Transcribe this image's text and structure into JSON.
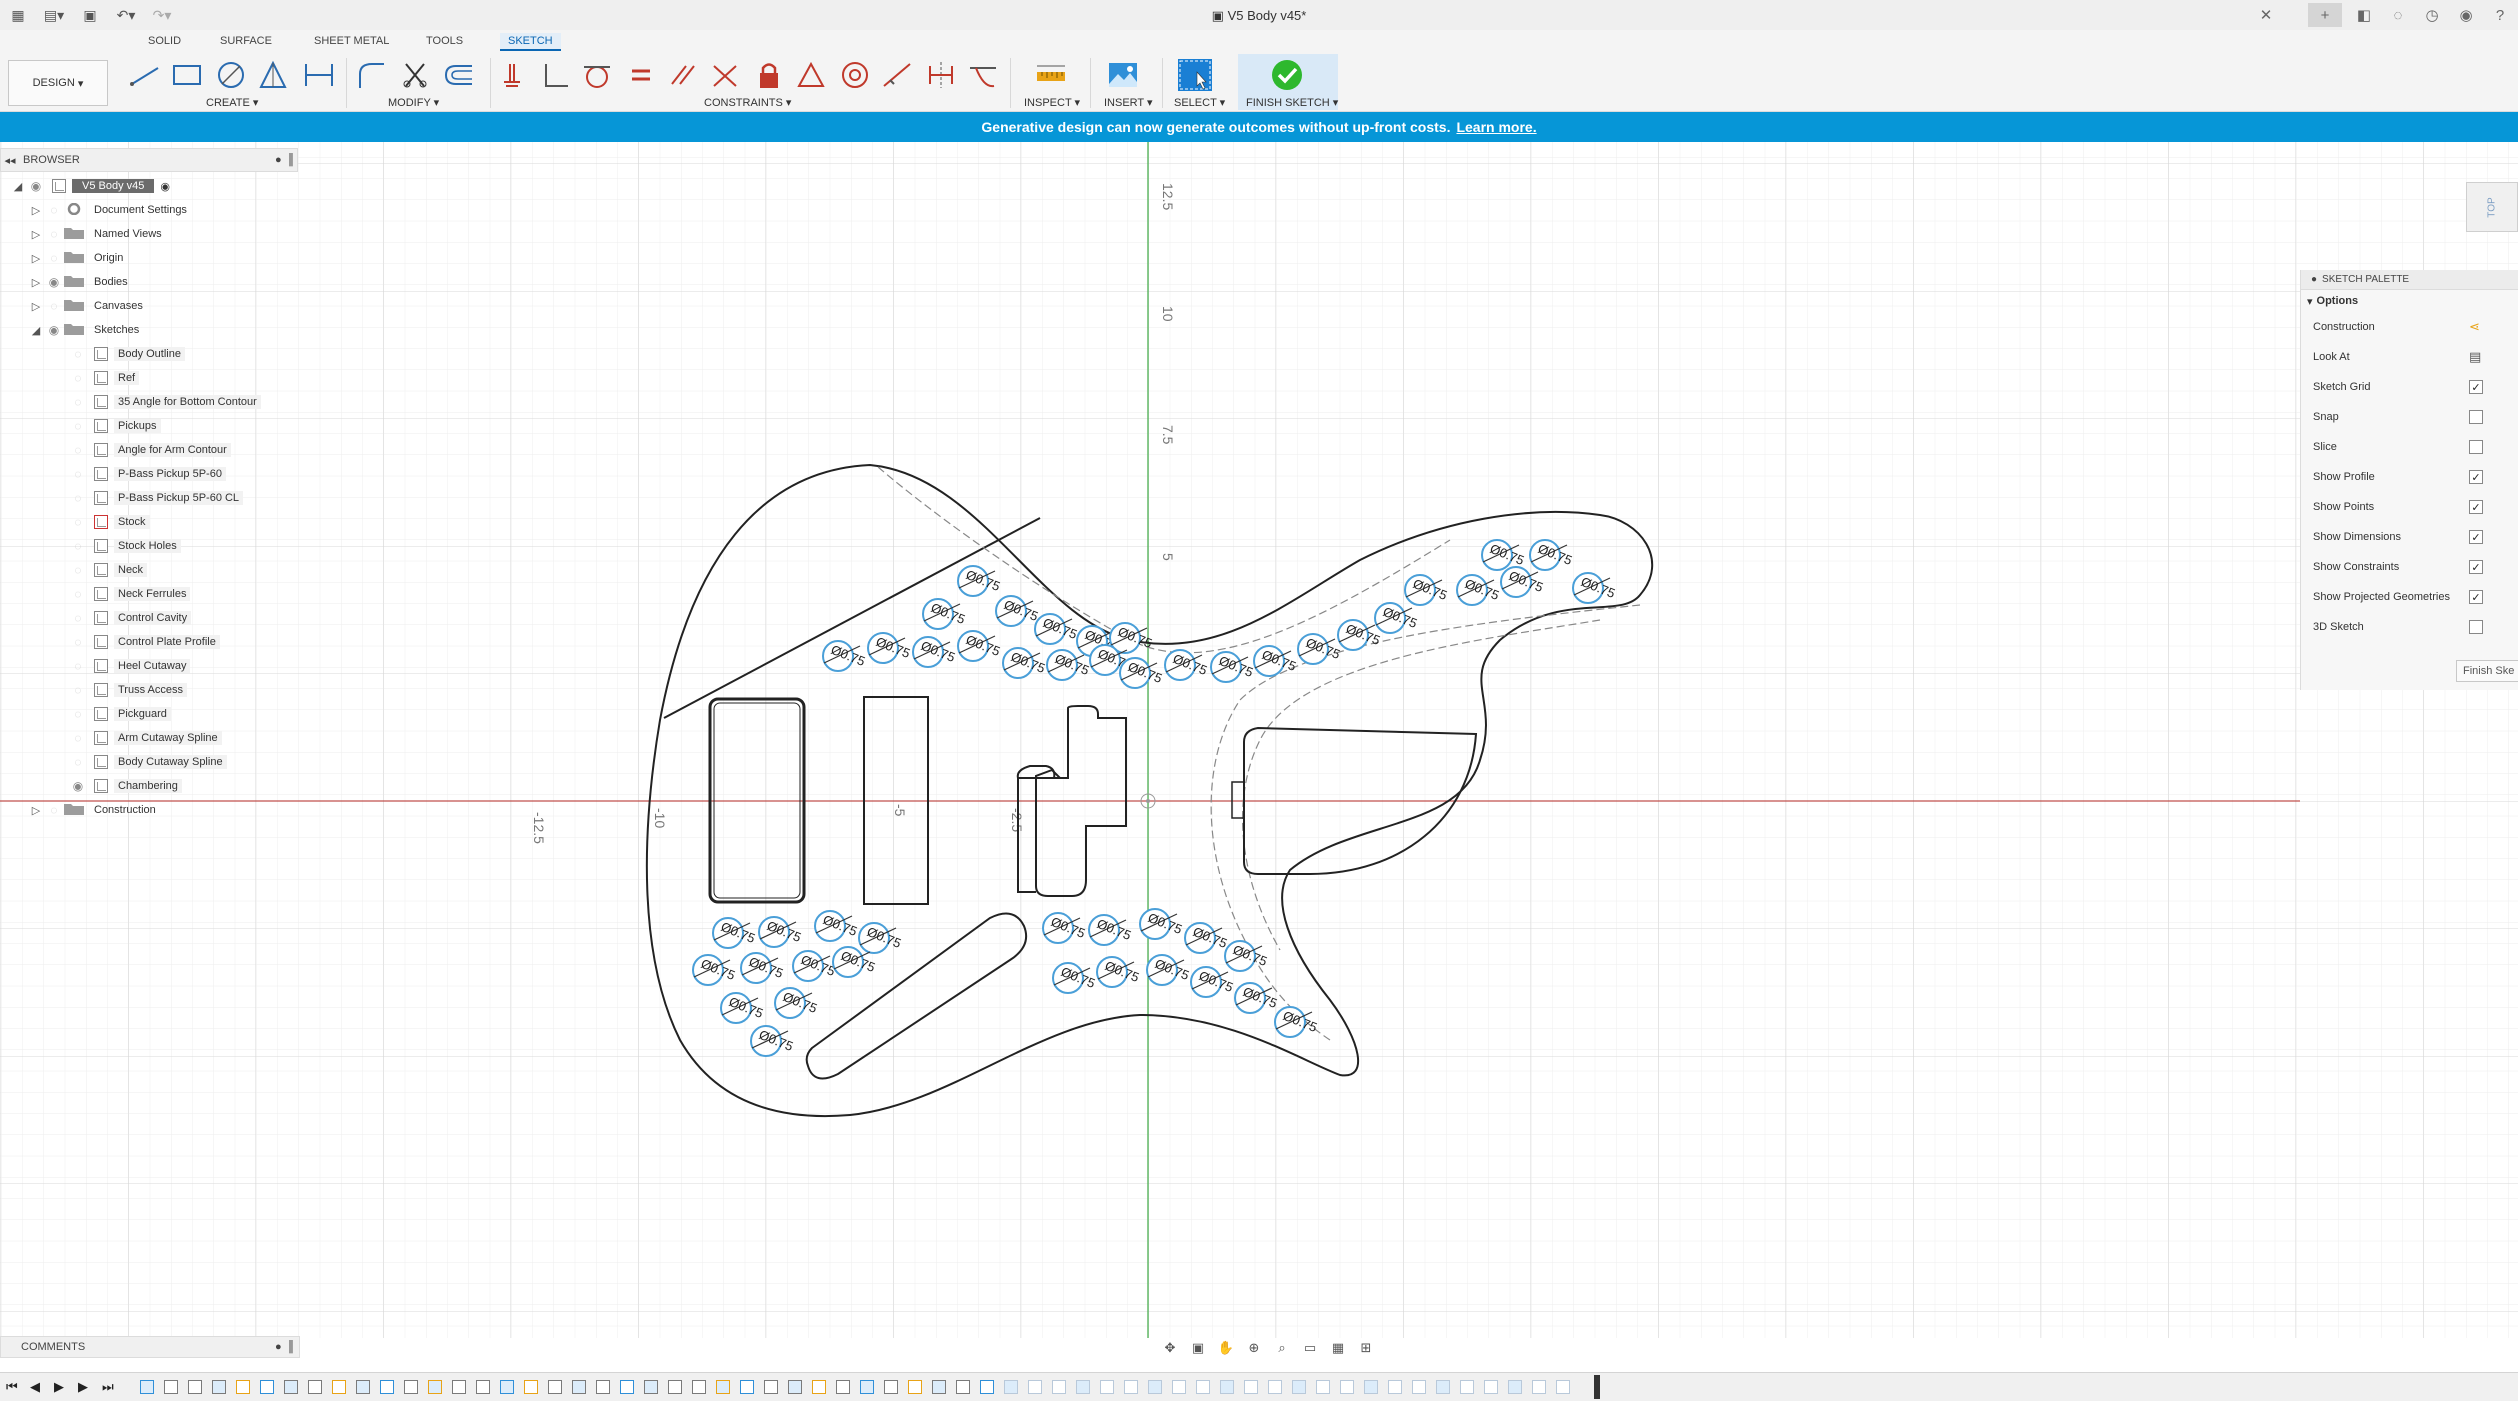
{
  "app": {
    "document_title": "V5 Body v45*",
    "workspace": "DESIGN"
  },
  "tabs": [
    "SOLID",
    "SURFACE",
    "SHEET METAL",
    "TOOLS",
    "SKETCH"
  ],
  "active_tab": "SKETCH",
  "toolbar": {
    "groups": {
      "create": "CREATE",
      "modify": "MODIFY",
      "constraints": "CONSTRAINTS",
      "inspect": "INSPECT",
      "insert": "INSERT",
      "select": "SELECT",
      "finish_sketch": "FINISH SKETCH"
    }
  },
  "banner": {
    "text": "Generative design can now generate outcomes without up-front costs.",
    "link": "Learn more."
  },
  "browser": {
    "title": "BROWSER",
    "root": "V5 Body v45",
    "top_items": [
      {
        "label": "Document Settings",
        "icon": "gear-icon",
        "visible": false
      },
      {
        "label": "Named Views",
        "icon": "folder-icon",
        "visible": false
      },
      {
        "label": "Origin",
        "icon": "folder-icon",
        "visible": false
      },
      {
        "label": "Bodies",
        "icon": "folder-icon",
        "visible": true
      },
      {
        "label": "Canvases",
        "icon": "folder-icon",
        "visible": false
      },
      {
        "label": "Sketches",
        "icon": "folder-icon",
        "visible": true
      }
    ],
    "sketches": [
      {
        "label": "Body Outline",
        "visible": false
      },
      {
        "label": "Ref",
        "visible": false
      },
      {
        "label": "35 Angle for Bottom Contour",
        "visible": false
      },
      {
        "label": "Pickups",
        "visible": false
      },
      {
        "label": "Angle for Arm Contour",
        "visible": false
      },
      {
        "label": "P-Bass Pickup 5P-60",
        "visible": false
      },
      {
        "label": "P-Bass Pickup 5P-60 CL",
        "visible": false
      },
      {
        "label": "Stock",
        "visible": false,
        "locked": true
      },
      {
        "label": "Stock Holes",
        "visible": false
      },
      {
        "label": "Neck",
        "visible": false
      },
      {
        "label": "Neck Ferrules",
        "visible": false
      },
      {
        "label": "Control Cavity",
        "visible": false
      },
      {
        "label": "Control Plate Profile",
        "visible": false
      },
      {
        "label": "Heel Cutaway",
        "visible": false
      },
      {
        "label": "Truss Access",
        "visible": false
      },
      {
        "label": "Pickguard",
        "visible": false
      },
      {
        "label": "Arm Cutaway Spline",
        "visible": false
      },
      {
        "label": "Body Cutaway Spline",
        "visible": false
      },
      {
        "label": "Chambering",
        "visible": true
      }
    ],
    "construction": "Construction"
  },
  "sketch_palette": {
    "title": "SKETCH PALETTE",
    "section": "Options",
    "options": [
      {
        "label": "Construction",
        "type": "icon",
        "checked": false
      },
      {
        "label": "Look At",
        "type": "icon",
        "checked": false
      },
      {
        "label": "Sketch Grid",
        "type": "checkbox",
        "checked": true
      },
      {
        "label": "Snap",
        "type": "checkbox",
        "checked": false
      },
      {
        "label": "Slice",
        "type": "checkbox",
        "checked": false
      },
      {
        "label": "Show Profile",
        "type": "checkbox",
        "checked": true
      },
      {
        "label": "Show Points",
        "type": "checkbox",
        "checked": true
      },
      {
        "label": "Show Dimensions",
        "type": "checkbox",
        "checked": true
      },
      {
        "label": "Show Constraints",
        "type": "checkbox",
        "checked": true
      },
      {
        "label": "Show Projected Geometries",
        "type": "checkbox",
        "checked": true
      },
      {
        "label": "3D Sketch",
        "type": "checkbox",
        "checked": false
      }
    ],
    "finish_button": "Finish Ske"
  },
  "viewcube": {
    "face": "TOP"
  },
  "comments": {
    "title": "COMMENTS"
  },
  "canvas": {
    "axis_labels_vertical": [
      "12.5",
      "10",
      "7.5",
      "5"
    ],
    "axis_labels_horizontal": [
      "-12.5",
      "-10",
      "-5",
      "-2.5"
    ],
    "hole_dimension": "Ø0.75"
  },
  "colors": {
    "accent": "#0696d7",
    "x_axis": "#c0504d",
    "y_axis": "#4caf50",
    "grid": "#e6e6e6",
    "hole_circle": "#4a9fd8",
    "finish_check": "#2eb82e"
  }
}
